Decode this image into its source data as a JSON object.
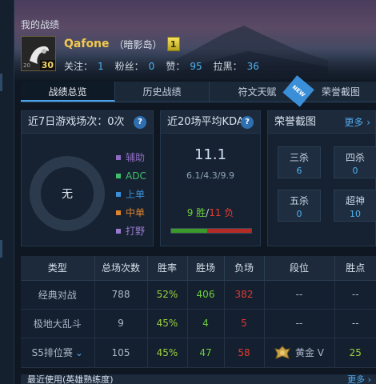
{
  "page_title": "我的战绩",
  "player": {
    "name": "Qafone",
    "server": "（暗影岛）",
    "level": "30",
    "avatar_mini": "20",
    "rank_badge": "1",
    "stats": [
      {
        "label": "关注：",
        "value": "1"
      },
      {
        "label": "粉丝：",
        "value": "0"
      },
      {
        "label": "赞：",
        "value": "95"
      },
      {
        "label": "拉黑：",
        "value": "36"
      }
    ]
  },
  "tabs": [
    {
      "label": "战绩总览",
      "active": true
    },
    {
      "label": "历史战绩",
      "active": false
    },
    {
      "label": "符文天赋",
      "active": false,
      "badge": "NEW"
    },
    {
      "label": "荣誉截图",
      "active": false
    }
  ],
  "recent_games": {
    "title": "近7日游戏场次：0次",
    "ring_center": "无",
    "roles": [
      {
        "label": "辅助",
        "color": "#8e6bc2"
      },
      {
        "label": "ADC",
        "color": "#3fbf6a"
      },
      {
        "label": "上单",
        "color": "#3a8fd8"
      },
      {
        "label": "中单",
        "color": "#e0822e"
      },
      {
        "label": "打野",
        "color": "#9a7ad0"
      }
    ]
  },
  "kda_panel": {
    "title": "近20场平均KDA",
    "kda": "11.1",
    "detail": "6.1/4.3/9.9",
    "wins": "9 胜",
    "separator": "/",
    "losses": "11 负",
    "win_fraction": 0.45
  },
  "honor_panel": {
    "title": "荣誉截图",
    "more": "更多",
    "cells": [
      {
        "label": "三杀",
        "value": "6"
      },
      {
        "label": "四杀",
        "value": "0"
      },
      {
        "label": "五杀",
        "value": "0"
      },
      {
        "label": "超神",
        "value": "10"
      }
    ]
  },
  "table": {
    "headers": [
      "类型",
      "总场次数",
      "胜率",
      "胜场",
      "负场",
      "段位",
      "胜点"
    ],
    "rows": [
      {
        "type": "经典对战",
        "total": "788",
        "rate": "52%",
        "wins": "406",
        "losses": "382",
        "tier": "--",
        "points": "--"
      },
      {
        "type": "极地大乱斗",
        "total": "9",
        "rate": "45%",
        "wins": "4",
        "losses": "5",
        "tier": "--",
        "points": "--"
      },
      {
        "type": "S5排位赛",
        "total": "105",
        "rate": "45%",
        "wins": "47",
        "losses": "58",
        "tier": "黄金 V",
        "points": "25"
      }
    ]
  },
  "bottom": {
    "title": "最近使用(英雄熟练度)",
    "more": "更多"
  },
  "colors": {
    "win_green": "#6ccf3a",
    "loss_red": "#e3392f",
    "link_blue": "#4fa8ee",
    "name_gold": "#f2c94c"
  }
}
